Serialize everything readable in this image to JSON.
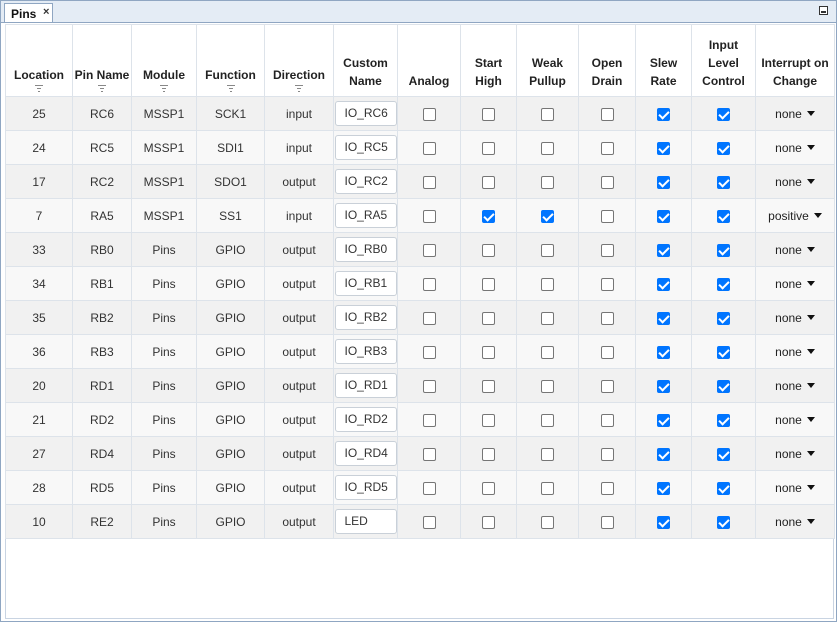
{
  "tab": {
    "label": "Pins",
    "close_glyph": "×"
  },
  "columns": [
    {
      "key": "location",
      "label": "Location",
      "sortable": true
    },
    {
      "key": "pin_name",
      "label": "Pin Name",
      "sortable": true
    },
    {
      "key": "module",
      "label": "Module",
      "sortable": true
    },
    {
      "key": "function",
      "label": "Function",
      "sortable": true
    },
    {
      "key": "direction",
      "label": "Direction",
      "sortable": true
    },
    {
      "key": "custom_name",
      "label": "Custom Name",
      "sortable": false
    },
    {
      "key": "analog",
      "label": "Analog",
      "sortable": false
    },
    {
      "key": "start_high",
      "label": "Start High",
      "sortable": false
    },
    {
      "key": "weak_pullup",
      "label": "Weak Pullup",
      "sortable": false
    },
    {
      "key": "open_drain",
      "label": "Open Drain",
      "sortable": false
    },
    {
      "key": "slew_rate",
      "label": "Slew Rate",
      "sortable": false
    },
    {
      "key": "input_level",
      "label": "Input Level Control",
      "sortable": false
    },
    {
      "key": "ioc",
      "label": "Interrupt on Change",
      "sortable": false
    }
  ],
  "rows": [
    {
      "location": "25",
      "pin_name": "RC6",
      "module": "MSSP1",
      "function": "SCK1",
      "direction": "input",
      "custom_name": "IO_RC6",
      "analog": false,
      "start_high": false,
      "weak_pullup": false,
      "open_drain": false,
      "slew_rate": true,
      "input_level": true,
      "ioc": "none"
    },
    {
      "location": "24",
      "pin_name": "RC5",
      "module": "MSSP1",
      "function": "SDI1",
      "direction": "input",
      "custom_name": "IO_RC5",
      "analog": false,
      "start_high": false,
      "weak_pullup": false,
      "open_drain": false,
      "slew_rate": true,
      "input_level": true,
      "ioc": "none"
    },
    {
      "location": "17",
      "pin_name": "RC2",
      "module": "MSSP1",
      "function": "SDO1",
      "direction": "output",
      "custom_name": "IO_RC2",
      "analog": false,
      "start_high": false,
      "weak_pullup": false,
      "open_drain": false,
      "slew_rate": true,
      "input_level": true,
      "ioc": "none"
    },
    {
      "location": "7",
      "pin_name": "RA5",
      "module": "MSSP1",
      "function": "SS1",
      "direction": "input",
      "custom_name": "IO_RA5",
      "analog": false,
      "start_high": true,
      "weak_pullup": true,
      "open_drain": false,
      "slew_rate": true,
      "input_level": true,
      "ioc": "positive"
    },
    {
      "location": "33",
      "pin_name": "RB0",
      "module": "Pins",
      "function": "GPIO",
      "direction": "output",
      "custom_name": "IO_RB0",
      "analog": false,
      "start_high": false,
      "weak_pullup": false,
      "open_drain": false,
      "slew_rate": true,
      "input_level": true,
      "ioc": "none"
    },
    {
      "location": "34",
      "pin_name": "RB1",
      "module": "Pins",
      "function": "GPIO",
      "direction": "output",
      "custom_name": "IO_RB1",
      "analog": false,
      "start_high": false,
      "weak_pullup": false,
      "open_drain": false,
      "slew_rate": true,
      "input_level": true,
      "ioc": "none"
    },
    {
      "location": "35",
      "pin_name": "RB2",
      "module": "Pins",
      "function": "GPIO",
      "direction": "output",
      "custom_name": "IO_RB2",
      "analog": false,
      "start_high": false,
      "weak_pullup": false,
      "open_drain": false,
      "slew_rate": true,
      "input_level": true,
      "ioc": "none"
    },
    {
      "location": "36",
      "pin_name": "RB3",
      "module": "Pins",
      "function": "GPIO",
      "direction": "output",
      "custom_name": "IO_RB3",
      "analog": false,
      "start_high": false,
      "weak_pullup": false,
      "open_drain": false,
      "slew_rate": true,
      "input_level": true,
      "ioc": "none"
    },
    {
      "location": "20",
      "pin_name": "RD1",
      "module": "Pins",
      "function": "GPIO",
      "direction": "output",
      "custom_name": "IO_RD1",
      "analog": false,
      "start_high": false,
      "weak_pullup": false,
      "open_drain": false,
      "slew_rate": true,
      "input_level": true,
      "ioc": "none"
    },
    {
      "location": "21",
      "pin_name": "RD2",
      "module": "Pins",
      "function": "GPIO",
      "direction": "output",
      "custom_name": "IO_RD2",
      "analog": false,
      "start_high": false,
      "weak_pullup": false,
      "open_drain": false,
      "slew_rate": true,
      "input_level": true,
      "ioc": "none"
    },
    {
      "location": "27",
      "pin_name": "RD4",
      "module": "Pins",
      "function": "GPIO",
      "direction": "output",
      "custom_name": "IO_RD4",
      "analog": false,
      "start_high": false,
      "weak_pullup": false,
      "open_drain": false,
      "slew_rate": true,
      "input_level": true,
      "ioc": "none"
    },
    {
      "location": "28",
      "pin_name": "RD5",
      "module": "Pins",
      "function": "GPIO",
      "direction": "output",
      "custom_name": "IO_RD5",
      "analog": false,
      "start_high": false,
      "weak_pullup": false,
      "open_drain": false,
      "slew_rate": true,
      "input_level": true,
      "ioc": "none"
    },
    {
      "location": "10",
      "pin_name": "RE2",
      "module": "Pins",
      "function": "GPIO",
      "direction": "output",
      "custom_name": "LED",
      "analog": false,
      "start_high": false,
      "weak_pullup": false,
      "open_drain": false,
      "slew_rate": true,
      "input_level": true,
      "ioc": "none"
    }
  ],
  "colors": {
    "checkbox_checked": "#0075ff",
    "tabbar_bg": "#e4ecf5",
    "border": "#8fa6c2"
  }
}
